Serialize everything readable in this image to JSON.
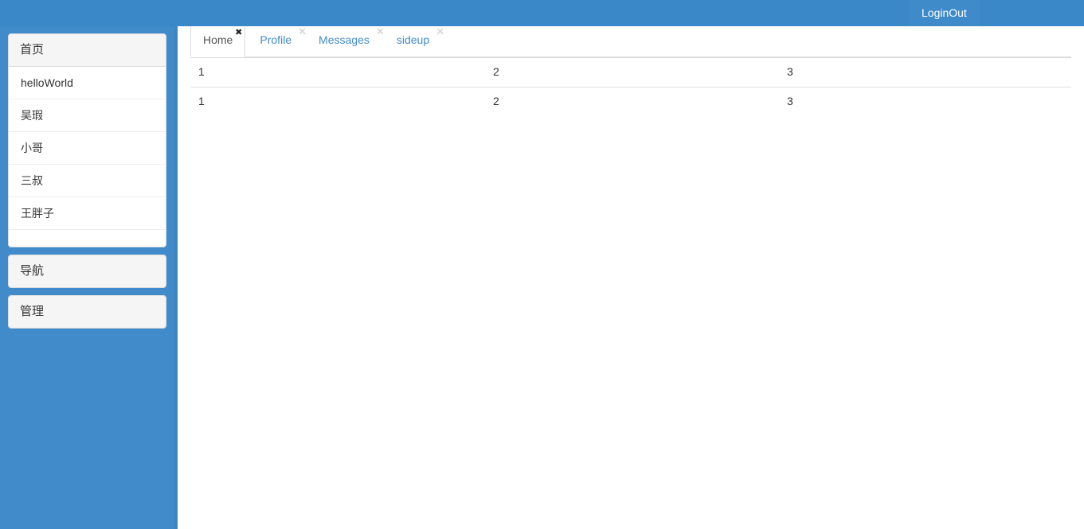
{
  "navbar": {
    "items": [
      {
        "label": "LoginOut",
        "name": "navbar-item-loginout"
      }
    ],
    "background_color": "#3b88c8"
  },
  "sidebar": {
    "background_color": "#428bca",
    "panels": [
      {
        "heading": "首页",
        "expanded": true,
        "items": [
          {
            "label": "helloWorld"
          },
          {
            "label": "吴瑕"
          },
          {
            "label": "小哥"
          },
          {
            "label": "三叔"
          },
          {
            "label": "王胖子"
          },
          {
            "label": ""
          }
        ]
      },
      {
        "heading": "导航",
        "expanded": false,
        "items": []
      },
      {
        "heading": "管理",
        "expanded": false,
        "items": []
      }
    ]
  },
  "main": {
    "tabs": [
      {
        "label": "Home",
        "active": true,
        "close_icon": "close-icon"
      },
      {
        "label": "Profile",
        "active": false,
        "close_icon": "close-icon"
      },
      {
        "label": "Messages",
        "active": false,
        "close_icon": "close-icon"
      },
      {
        "label": "sideup",
        "active": false,
        "close_icon": "close-icon"
      }
    ],
    "tab_close_glyph_active": "✖",
    "tab_close_glyph_inactive": "✕",
    "table": {
      "rows": [
        [
          "1",
          "2",
          "3"
        ],
        [
          "1",
          "2",
          "3"
        ]
      ]
    }
  }
}
